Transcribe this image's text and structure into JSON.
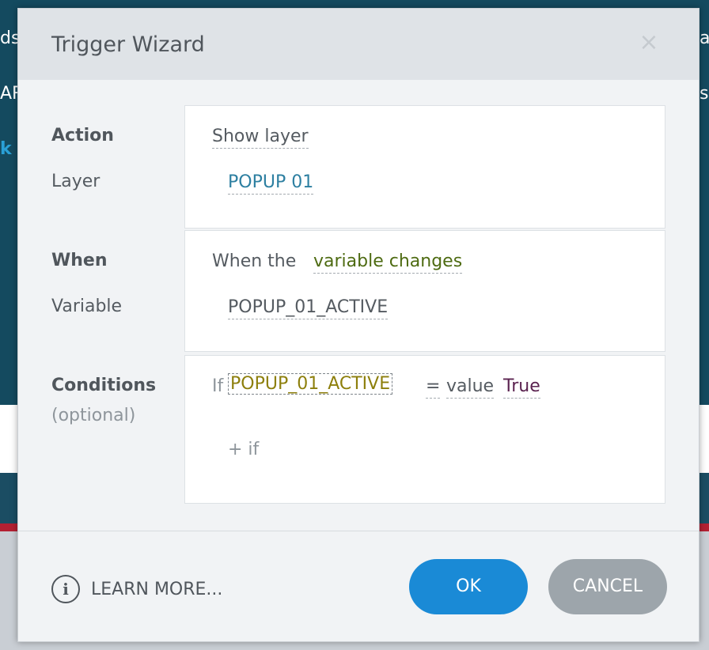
{
  "background": {
    "fragment_left_1": "ds",
    "fragment_left_2": "AR",
    "fragment_left_3": "k",
    "fragment_right_1": "a",
    "fragment_right_2": "s"
  },
  "dialog": {
    "title": "Trigger Wizard",
    "close_icon": "×"
  },
  "action": {
    "label": "Action",
    "value": "Show layer",
    "sub_label": "Layer",
    "sub_value": "POPUP 01"
  },
  "when": {
    "label": "When",
    "prefix": "When the",
    "event": "variable changes",
    "sub_label": "Variable",
    "sub_value": "POPUP_01_ACTIVE"
  },
  "conditions": {
    "label": "Conditions",
    "optional": "(optional)",
    "if_word": "If",
    "variable": "POPUP_01_ACTIVE",
    "operator": "=",
    "value_type": "value",
    "value": "True",
    "add_if": "+ if"
  },
  "footer": {
    "info_icon": "i",
    "learn_more": "LEARN MORE...",
    "ok": "OK",
    "cancel": "CANCEL"
  },
  "colors": {
    "ok_button": "#1a8ad6",
    "cancel_button": "#9da5ab",
    "layer_value": "#2d7fa1",
    "event_value": "#4e6b12",
    "condition_variable": "#8d7f0c",
    "condition_value": "#5b2350"
  }
}
